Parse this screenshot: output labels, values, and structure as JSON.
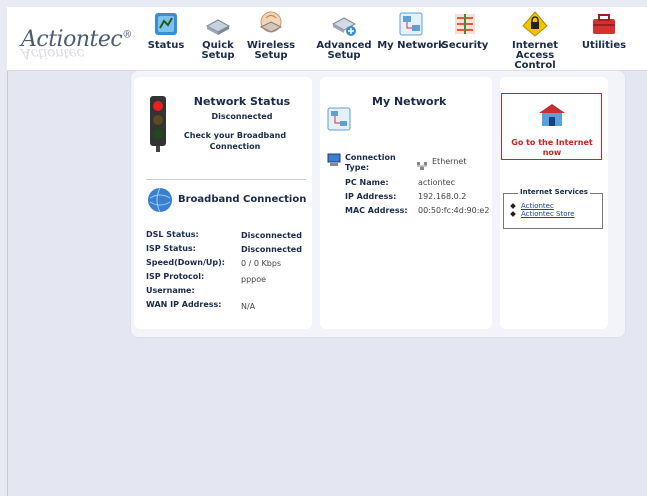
{
  "brand": {
    "logo": "Actiontec",
    "reg": "®"
  },
  "nav": [
    {
      "label": "Status",
      "icon": "status-icon",
      "color": "#3a8fd0"
    },
    {
      "label": "Quick\nSetup",
      "icon": "router-icon",
      "color": "#9aa7b8"
    },
    {
      "label": "Wireless\nSetup",
      "icon": "wireless-router-icon",
      "color": "#c99a6a"
    },
    {
      "label": "Advanced\nSetup",
      "icon": "advanced-router-icon",
      "color": "#8b98a8"
    },
    {
      "label": "My Network",
      "icon": "network-icon",
      "color": "#5ea0d6"
    },
    {
      "label": "Security",
      "icon": "security-icon",
      "color": "#e05a3a"
    },
    {
      "label": "Internet Access\nControl",
      "icon": "lock-icon",
      "color": "#f0c400"
    },
    {
      "label": "Utilities",
      "icon": "toolbox-icon",
      "color": "#d63030"
    }
  ],
  "network_status": {
    "title": "Network Status",
    "state": "Disconnected",
    "hint": "Check your Broadband Connection"
  },
  "broadband": {
    "title": "Broadband Connection",
    "rows": [
      {
        "label": "DSL Status:",
        "value": "Disconnected"
      },
      {
        "label": "ISP Status:",
        "value": "Disconnected"
      },
      {
        "label": "Speed(Down/Up):",
        "value": "0 / 0 Kbps"
      },
      {
        "label": "ISP Protocol:",
        "value": "pppoe"
      },
      {
        "label": "Username:",
        "value": ""
      },
      {
        "label": "WAN IP Address:",
        "value": "N/A"
      }
    ]
  },
  "my_network": {
    "title": "My Network",
    "connection_type_label": "Connection Type:",
    "connection_type_value": "Ethernet",
    "rows": [
      {
        "label": "PC Name:",
        "value": "actiontec"
      },
      {
        "label": "IP Address:",
        "value": "192.168.0.2"
      },
      {
        "label": "MAC Address:",
        "value": "00:50:fc:4d:90:e2"
      }
    ]
  },
  "internet": {
    "goto_label": "Go to the Internet now",
    "services_title": "Internet Services",
    "links": [
      "Actiontec",
      "Actiontec Store"
    ]
  },
  "colors": {
    "nav_text": "#1a2a4a",
    "accent_red": "#cc2222",
    "link": "#1a3faa"
  }
}
